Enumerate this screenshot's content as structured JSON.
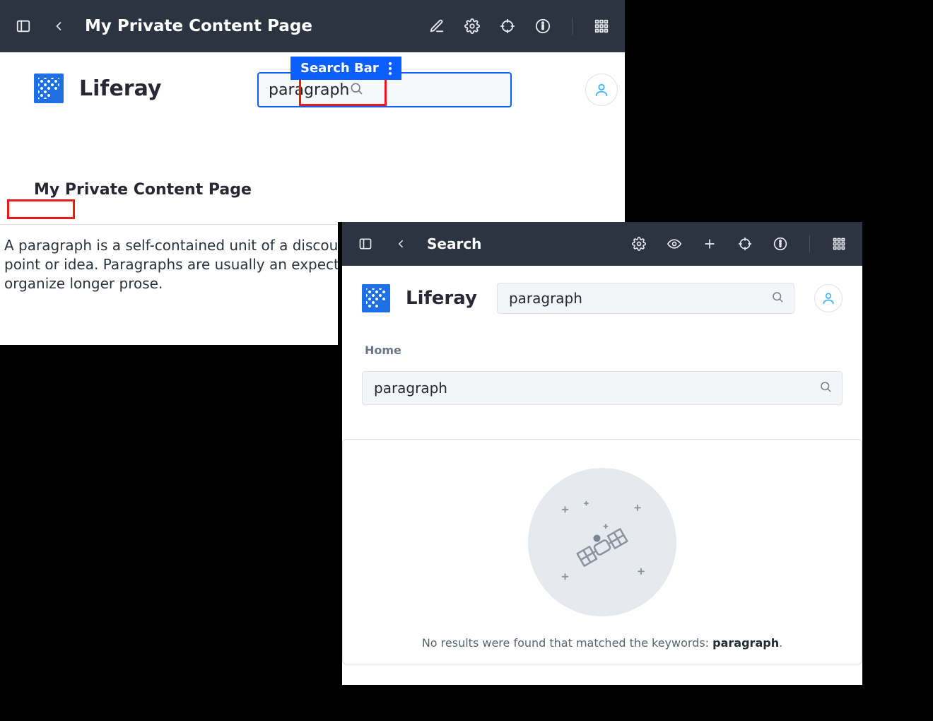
{
  "panel1": {
    "toolbar": {
      "title": "My Private Content Page"
    },
    "brand": "Liferay",
    "fragment_label": "Search Bar",
    "search": {
      "value": "paragraph"
    },
    "page_heading": "My Private Content Page",
    "body_prefix": "A ",
    "body_keyword": "paragraph",
    "body_rest": " is a self-contained unit of a discourse in writing dealing with a particular point or idea. Paragraphs are usually an expected part of formal writing, used to organize longer prose."
  },
  "panel2": {
    "toolbar": {
      "title": "Search"
    },
    "brand": "Liferay",
    "search_top": {
      "value": "paragraph"
    },
    "breadcrumb": "Home",
    "search_full": {
      "value": "paragraph"
    },
    "no_results_lead": "No results were found that matched the keywords: ",
    "no_results_kw": "paragraph",
    "no_results_tail": "."
  }
}
